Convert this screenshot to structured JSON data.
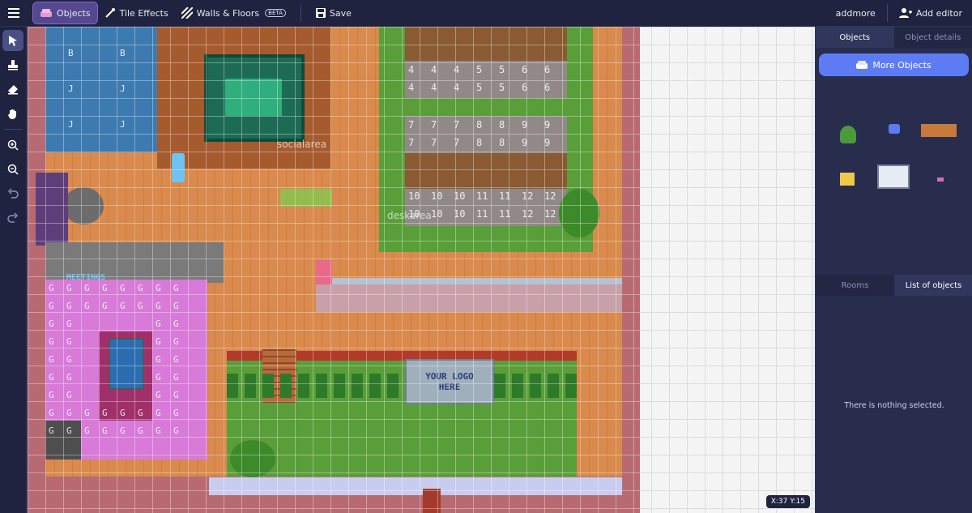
{
  "topbar": {
    "objects": "Objects",
    "tile_effects": "Tile Effects",
    "walls_floors": "Walls & Floors",
    "beta": "BETA",
    "save": "Save",
    "addmore": "addmore",
    "add_editor": "Add editor"
  },
  "map": {
    "social_area": "socialarea",
    "desk_area": "deskarea",
    "meetings_sign": "MEETINGS",
    "logo_line1": "YOUR LOGO",
    "logo_line2": "HERE",
    "coords": "X:37  Y:15",
    "desk_rows": [
      [
        "4",
        "4",
        "4",
        "5",
        "5",
        "6",
        "6"
      ],
      [
        "4",
        "4",
        "4",
        "5",
        "5",
        "6",
        "6"
      ],
      [
        "7",
        "7",
        "7",
        "8",
        "8",
        "9",
        "9"
      ],
      [
        "7",
        "7",
        "7",
        "8",
        "8",
        "9",
        "9"
      ],
      [
        "10",
        "10",
        "10",
        "11",
        "11",
        "12",
        "12"
      ],
      [
        "10",
        "10",
        "10",
        "11",
        "11",
        "12",
        "12"
      ]
    ],
    "room_letters": {
      "b": "B",
      "j": "J",
      "g": "G"
    }
  },
  "panel": {
    "tab_objects": "Objects",
    "tab_details": "Object details",
    "more_objects": "More Objects",
    "tab_rooms": "Rooms",
    "tab_list": "List of objects",
    "empty": "There is nothing selected."
  },
  "colors": {
    "accent": "#5d7cf3",
    "topbar": "#1f2340",
    "panel": "#282d4e"
  }
}
